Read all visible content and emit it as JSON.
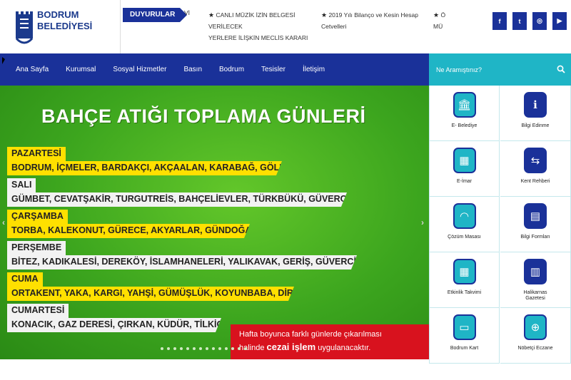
{
  "logo": {
    "line1": "BODRUM",
    "line2": "BELEDİYESİ",
    "crest_top": "BODRUM",
    "crest_bottom": "BELEDİYESİ"
  },
  "announcements": {
    "tag": "DUYURULAR",
    "prev_fragment": "Vİ",
    "items": [
      {
        "line1": "CANLI MÜZİK İZİN BELGESİ VERİLECEK",
        "line2": "YERLERE İLİŞKİN MECLİS KARARI"
      },
      {
        "line1": "2019 Yılı Bilanço ve Kesin Hesap",
        "line2": "Cetvelleri"
      }
    ],
    "next_fragment": {
      "line1": "Ö",
      "line2": "MÜ"
    }
  },
  "social": [
    {
      "icon": "facebook-icon",
      "glyph": "f"
    },
    {
      "icon": "twitter-icon",
      "glyph": "t"
    },
    {
      "icon": "instagram-icon",
      "glyph": "◎"
    },
    {
      "icon": "youtube-icon",
      "glyph": "▶"
    }
  ],
  "nav": {
    "items": [
      "Ana Sayfa",
      "Kurumsal",
      "Sosyal Hizmetler",
      "Basın",
      "Bodrum",
      "Tesisler",
      "İletişim"
    ]
  },
  "search": {
    "placeholder": "Ne Aramıştınız?",
    "icon": "search-icon"
  },
  "banner": {
    "title": "BAHÇE ATIĞI TOPLAMA GÜNLERİ",
    "days": [
      {
        "name": "PAZARTESİ",
        "places": "BODRUM, İÇMELER, BARDAKÇI, AKÇAALAN, KARABAĞ, GÖLKÖY",
        "style": "yellow"
      },
      {
        "name": "SALI",
        "places": "GÜMBET, CEVATŞAKİR, TURGUTREİS, BAHÇELİEVLER, TÜRKBÜKÜ, GÜVERCİNLİK",
        "style": "white"
      },
      {
        "name": "ÇARŞAMBA",
        "places": "TORBA, KALEKONUT, GÜRECE, AKYARLAR, GÜNDOĞAN",
        "style": "yellow"
      },
      {
        "name": "PERŞEMBE",
        "places": "BİTEZ, KADIKALESİ, DEREKÖY, İSLAMHANELERİ, YALIKAVAK, GERİŞ,  GÜVERCİNLİK",
        "style": "white"
      },
      {
        "name": "CUMA",
        "places": "ORTAKENT, YAKA, KARGI, YAHŞİ, GÜMÜŞLÜK, KOYUNBABA, DİRMİL",
        "style": "yellow"
      },
      {
        "name": "CUMARTESİ",
        "places": "KONACIK, GAZ DERESİ, ÇIRKAN, KÜDÜR, TİLKİCİK",
        "style": "white"
      }
    ],
    "notice": {
      "line1": "Hafta boyunca farklı günlerde çıkarılması",
      "line2_pre": "halinde ",
      "line2_bold": "cezai işlem",
      "line2_post": " uygulanacaktır."
    },
    "slide_count": 14
  },
  "services": [
    {
      "label": "E- Belediye",
      "icon": "municipality-building-icon"
    },
    {
      "label": "Bilgi Edinme",
      "icon": "info-icon"
    },
    {
      "label": "E-İmar",
      "icon": "map-icon"
    },
    {
      "label": "Kent Rehberi",
      "icon": "signpost-icon"
    },
    {
      "label": "Çözüm Masası",
      "icon": "headset-icon"
    },
    {
      "label": "Bilgi Formları",
      "icon": "document-icon"
    },
    {
      "label": "Etkinlik Takvimi",
      "icon": "calendar-icon"
    },
    {
      "label": "Halikarnas Gazetesi",
      "label_line1": "Halikarnas",
      "label_line2": "Gazetesi",
      "icon": "newspaper-icon"
    },
    {
      "label": "Bodrum Kart",
      "icon": "card-icon"
    },
    {
      "label": "Nöbetçi Eczane",
      "icon": "pharmacy-icon"
    }
  ],
  "colors": {
    "primary": "#1a3199",
    "accent": "#1fb5c6",
    "banner_green": "#3ca51e",
    "highlight_yellow": "#ffe000",
    "notice_red": "#d8121e"
  }
}
